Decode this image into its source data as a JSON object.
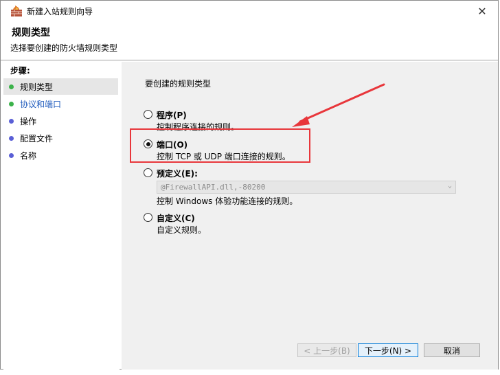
{
  "window": {
    "title": "新建入站规则向导",
    "close_glyph": "✕"
  },
  "header": {
    "title": "规则类型",
    "subtitle": "选择要创建的防火墙规则类型"
  },
  "sidebar": {
    "steps_label": "步骤:",
    "items": [
      {
        "label": "规则类型",
        "dot_color": "#3bb24a"
      },
      {
        "label": "协议和端口",
        "dot_color": "#3bb24a"
      },
      {
        "label": "操作",
        "dot_color": "#5a5fd6"
      },
      {
        "label": "配置文件",
        "dot_color": "#5a5fd6"
      },
      {
        "label": "名称",
        "dot_color": "#5a5fd6"
      }
    ]
  },
  "main": {
    "prompt": "要创建的规则类型",
    "options": [
      {
        "title": "程序(P)",
        "desc": "控制程序连接的规则。",
        "checked": false
      },
      {
        "title": "端口(O)",
        "desc": "控制 TCP 或 UDP 端口连接的规则。",
        "checked": true
      },
      {
        "title": "预定义(E):",
        "desc": "控制 Windows 体验功能连接的规则。",
        "checked": false
      },
      {
        "title": "自定义(C)",
        "desc": "自定义规则。",
        "checked": false
      }
    ],
    "predefined_combo": {
      "value": "@FirewallAPI.dll,-80200"
    }
  },
  "buttons": {
    "back": "< 上一步(B)",
    "next": "下一步(N) >",
    "cancel": "取消"
  },
  "colors": {
    "annotation": "#e8363b",
    "link": "#1f5bbd",
    "content_bg": "#f0f0f0"
  }
}
